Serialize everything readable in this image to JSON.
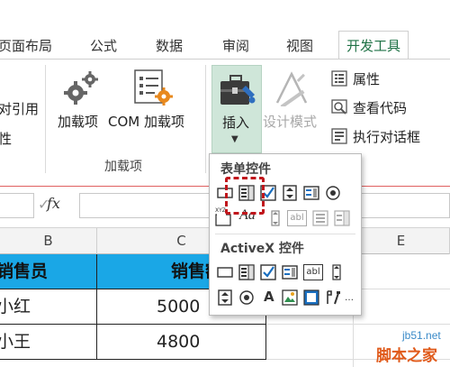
{
  "ribbon": {
    "tabs": [
      "页面布局",
      "公式",
      "数据",
      "审阅",
      "视图",
      "开发工具"
    ],
    "active_tab": "开发工具",
    "left_partial": [
      "对引用",
      "性"
    ],
    "addins_button": "加载项",
    "com_addins_button": "COM 加载项",
    "group_label": "加载项",
    "insert_button": "插入",
    "design_mode_button": "设计模式",
    "properties": "属性",
    "view_code": "查看代码",
    "run_dialog": "执行对话框"
  },
  "formula_bar": {
    "check": "✓",
    "fx": "fx"
  },
  "grid": {
    "columns": [
      "B",
      "C",
      "E"
    ],
    "header_row": [
      "销售员",
      "销售额"
    ],
    "rows": [
      [
        "小红",
        "5000"
      ],
      [
        "小王",
        "4800"
      ]
    ]
  },
  "dropdown": {
    "form_controls_heading": "表单控件",
    "activex_heading": "ActiveX 控件",
    "aa_label": "Aa",
    "abl_label": "abl",
    "a_label": "A",
    "xyz_label": "XYZ"
  },
  "watermark": {
    "url": "jb51.net",
    "text": "脚本之家"
  },
  "colors": {
    "accent_green": "#1e7145",
    "header_fill": "#1aa7e6",
    "highlight_red": "#c0161c",
    "insert_bg": "#cfe6d9"
  }
}
